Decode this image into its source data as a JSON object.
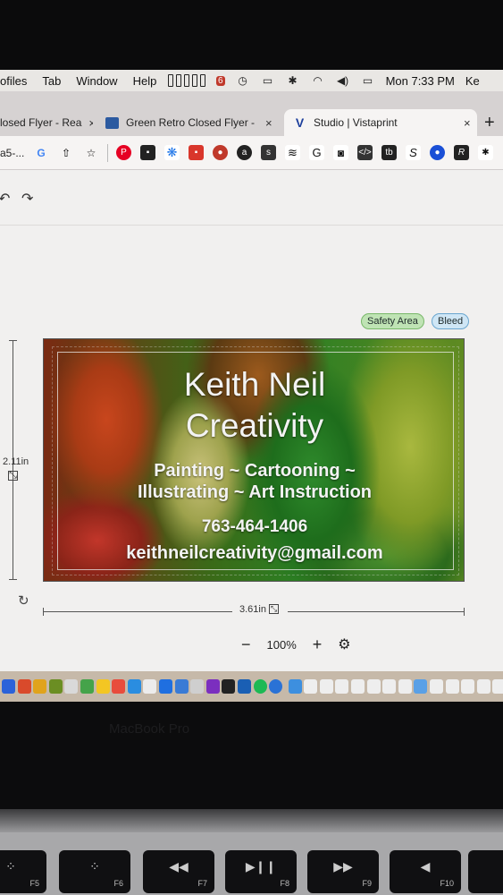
{
  "menubar": {
    "items": [
      "ofiles",
      "Tab",
      "Window",
      "Help"
    ],
    "clock": "Mon 7:33 PM",
    "user_fragment": "Ke",
    "badge": "6"
  },
  "tabs": [
    {
      "title": "losed Flyer - Rea",
      "close": "×"
    },
    {
      "title": "Green Retro Closed Flyer - Rea",
      "close": "×"
    },
    {
      "title": "Studio | Vistaprint",
      "close": "×"
    }
  ],
  "new_tab": "+",
  "toolbar": {
    "url_fragment": "a5-...",
    "icons": [
      "google-icon",
      "share-icon",
      "bookmark-star-icon"
    ]
  },
  "editor": {
    "undo": "↶",
    "redo": "↷",
    "safety_area": "Safety Area",
    "bleed": "Bleed",
    "height_label": "2.11in",
    "width_label": "3.61in",
    "zoom_minus": "−",
    "zoom_value": "100%",
    "zoom_plus": "+",
    "settings": "⚙"
  },
  "card": {
    "name_line1": "Keith Neil",
    "name_line2": "Creativity",
    "services_line1": "Painting ~ Cartooning ~",
    "services_line2": "Illustrating ~ Art Instruction",
    "phone": "763-464-1406",
    "email": "keithneilcreativity@gmail.com"
  },
  "laptop": {
    "brand": "MacBook Pro",
    "keys": [
      {
        "label": "F5",
        "symbol": "⁘"
      },
      {
        "label": "F6",
        "symbol": "⁘"
      },
      {
        "label": "F7",
        "symbol": "◀◀"
      },
      {
        "label": "F8",
        "symbol": "▶❙❙"
      },
      {
        "label": "F9",
        "symbol": "▶▶"
      },
      {
        "label": "F10",
        "symbol": "◀"
      }
    ]
  },
  "colors": {
    "safety_green": "#bfe3b4",
    "bleed_blue": "#cfe6f5",
    "vistaprint_blue": "#1d3f9c"
  }
}
